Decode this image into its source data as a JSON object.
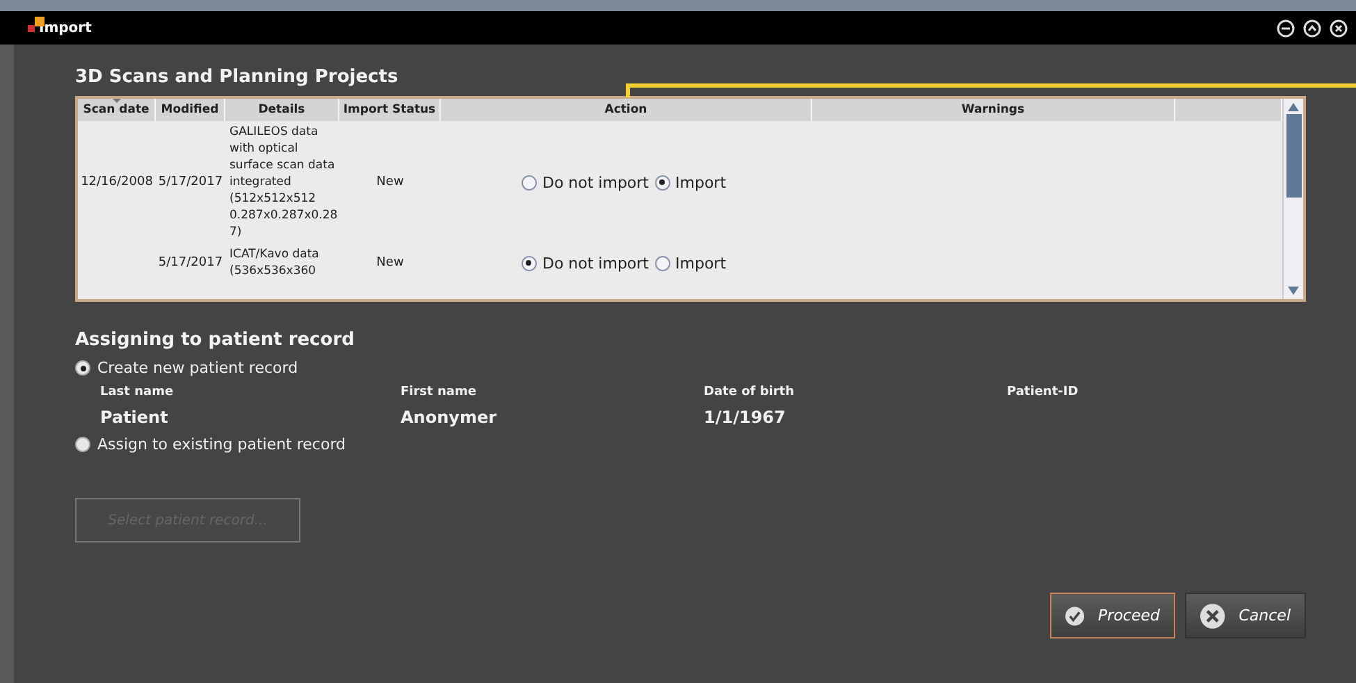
{
  "window": {
    "title": "Import"
  },
  "scans": {
    "title": "3D Scans and Planning Projects",
    "columns": [
      "Scan date",
      "Modified",
      "Details",
      "Import Status",
      "Action",
      "Warnings"
    ],
    "rows": [
      {
        "scan_date": "12/16/2008",
        "modified": "5/17/2017",
        "details": "GALILEOS data with optical surface scan data integrated (512x512x512 0.287x0.287x0.28 7)",
        "status": "New",
        "options": [
          {
            "label": "Do not import",
            "selected": false
          },
          {
            "label": "Import",
            "selected": true
          }
        ]
      },
      {
        "modified": "5/17/2017",
        "details": "ICAT/Kavo data (536x536x360",
        "status": "New",
        "options": [
          {
            "label": "Do not import",
            "selected": true
          },
          {
            "label": "Import",
            "selected": false
          }
        ]
      }
    ]
  },
  "assign": {
    "title": "Assigning to patient record",
    "options": [
      {
        "label": "Create new patient record",
        "selected": true
      },
      {
        "label": "Assign to existing patient record",
        "selected": false
      }
    ],
    "fields": [
      {
        "label": "Last name",
        "value": "Patient"
      },
      {
        "label": "First name",
        "value": "Anonymer"
      },
      {
        "label": "Date of birth",
        "value": "1/1/1967"
      },
      {
        "label": "Patient-ID"
      }
    ],
    "select_button": {
      "label": "Select patient record...",
      "disabled": true
    }
  },
  "buttons": [
    {
      "kind": "proceed",
      "label": "Proceed",
      "focused": true
    },
    {
      "kind": "cancel",
      "label": "Cancel",
      "focused": false
    }
  ]
}
